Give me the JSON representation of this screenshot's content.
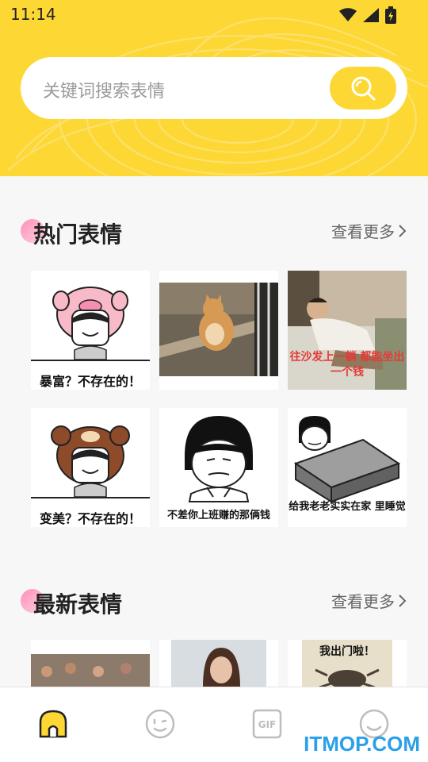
{
  "status": {
    "time": "11:14"
  },
  "search": {
    "placeholder": "关键词搜索表情"
  },
  "hot": {
    "title": "热门表情",
    "more": "查看更多",
    "items": [
      {
        "caption": "暴富？不存在的！"
      },
      {
        "caption": ""
      },
      {
        "caption": "往沙发上一躺 都能坐出一个钱"
      },
      {
        "caption": "变美？不存在的！"
      },
      {
        "caption": "不差你上班赚的那俩钱"
      },
      {
        "caption": "给我老老实实在家 里睡觉"
      }
    ]
  },
  "latest": {
    "title": "最新表情",
    "more": "查看更多",
    "items": [
      {
        "caption": ""
      },
      {
        "caption": ""
      },
      {
        "caption": "我出门啦！"
      }
    ]
  },
  "nav": {
    "items": [
      {
        "icon": "home-icon",
        "active": true
      },
      {
        "icon": "emoji-icon",
        "active": false
      },
      {
        "icon": "gif-icon",
        "active": false,
        "label": "GIF"
      },
      {
        "icon": "smile-icon",
        "active": false
      }
    ]
  },
  "watermark": "ITMOP.COM",
  "colors": {
    "accent": "#fdd835",
    "dot": "#ff8fb8",
    "caption_red": "#e53935"
  }
}
